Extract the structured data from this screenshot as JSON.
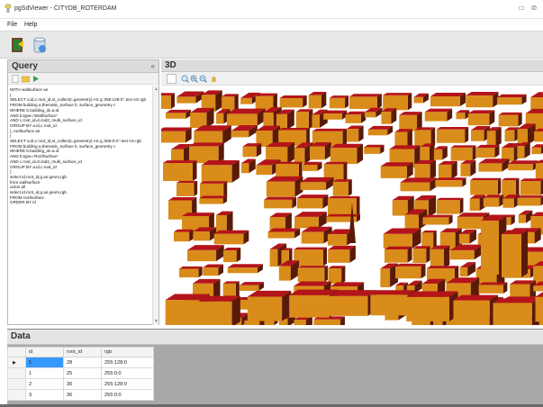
{
  "window": {
    "title": "pgSdViewer - CITYDB_ROTERDAM",
    "minimize_glyph": "▭",
    "close_glyph": "⊘"
  },
  "menu": {
    "file": "File",
    "help": "Help"
  },
  "toolbar": {
    "icons": [
      "exit-door-icon",
      "database-icon"
    ]
  },
  "query_panel": {
    "title": "Query",
    "collapse_glyph": "«",
    "toolbar_icons": [
      "new-document-icon",
      "open-folder-icon",
      "run-icon"
    ],
    "sql_lines": [
      "WITH wallsurface as",
      "(",
      "SELECT a.id,c.root_id,st_collect(c.geometry) AS g,'255:128:0'::text AS rgb",
      "FROM building a,thematic_surface b, surface_geometry c",
      "WHERE b.building_id=a.id",
      "AND b.type='WallSurface'",
      "AND c.root_id=b.lod2_multi_surface_id",
      "GROUP BY a.id,c.root_id",
      "), roofsurface as",
      "(",
      "SELECT a.id,c.root_id,st_collect(c.geometry) AS g,'255:0:0'::text AS rgb",
      "FROM building a,thematic_surface b, surface_geometry c",
      "WHERE b.building_id=a.id",
      "AND b.type='RoofSurface'",
      "AND c.root_id=b.lod2_multi_surface_id",
      "GROUP BY a.id,c.root_id",
      ")",
      "select id,root_id,g as geom,rgb",
      "from wallsurface",
      "union all",
      "select id,root_id,g as geom,rgb",
      "FROM roofsurface",
      "ORDER BY id"
    ]
  },
  "view_panel": {
    "title": "3D",
    "toolbar_icons": [
      "select-box-icon",
      "zoom-fit-icon",
      "zoom-in-icon",
      "zoom-out-icon",
      "pan-hand-icon"
    ],
    "colors": {
      "wall": "#d98c1a",
      "roof": "#b3141a",
      "shadow": "#5a1a08"
    }
  },
  "data_panel": {
    "title": "Data",
    "columns": [
      "id",
      "root_id",
      "rgb"
    ],
    "row_marker": "▶",
    "rows": [
      [
        "1",
        "28",
        "255:128:0"
      ],
      [
        "1",
        "25",
        "255:0:0"
      ],
      [
        "2",
        "30",
        "255:128:0"
      ],
      [
        "3",
        "36",
        "255:0:0"
      ]
    ]
  }
}
